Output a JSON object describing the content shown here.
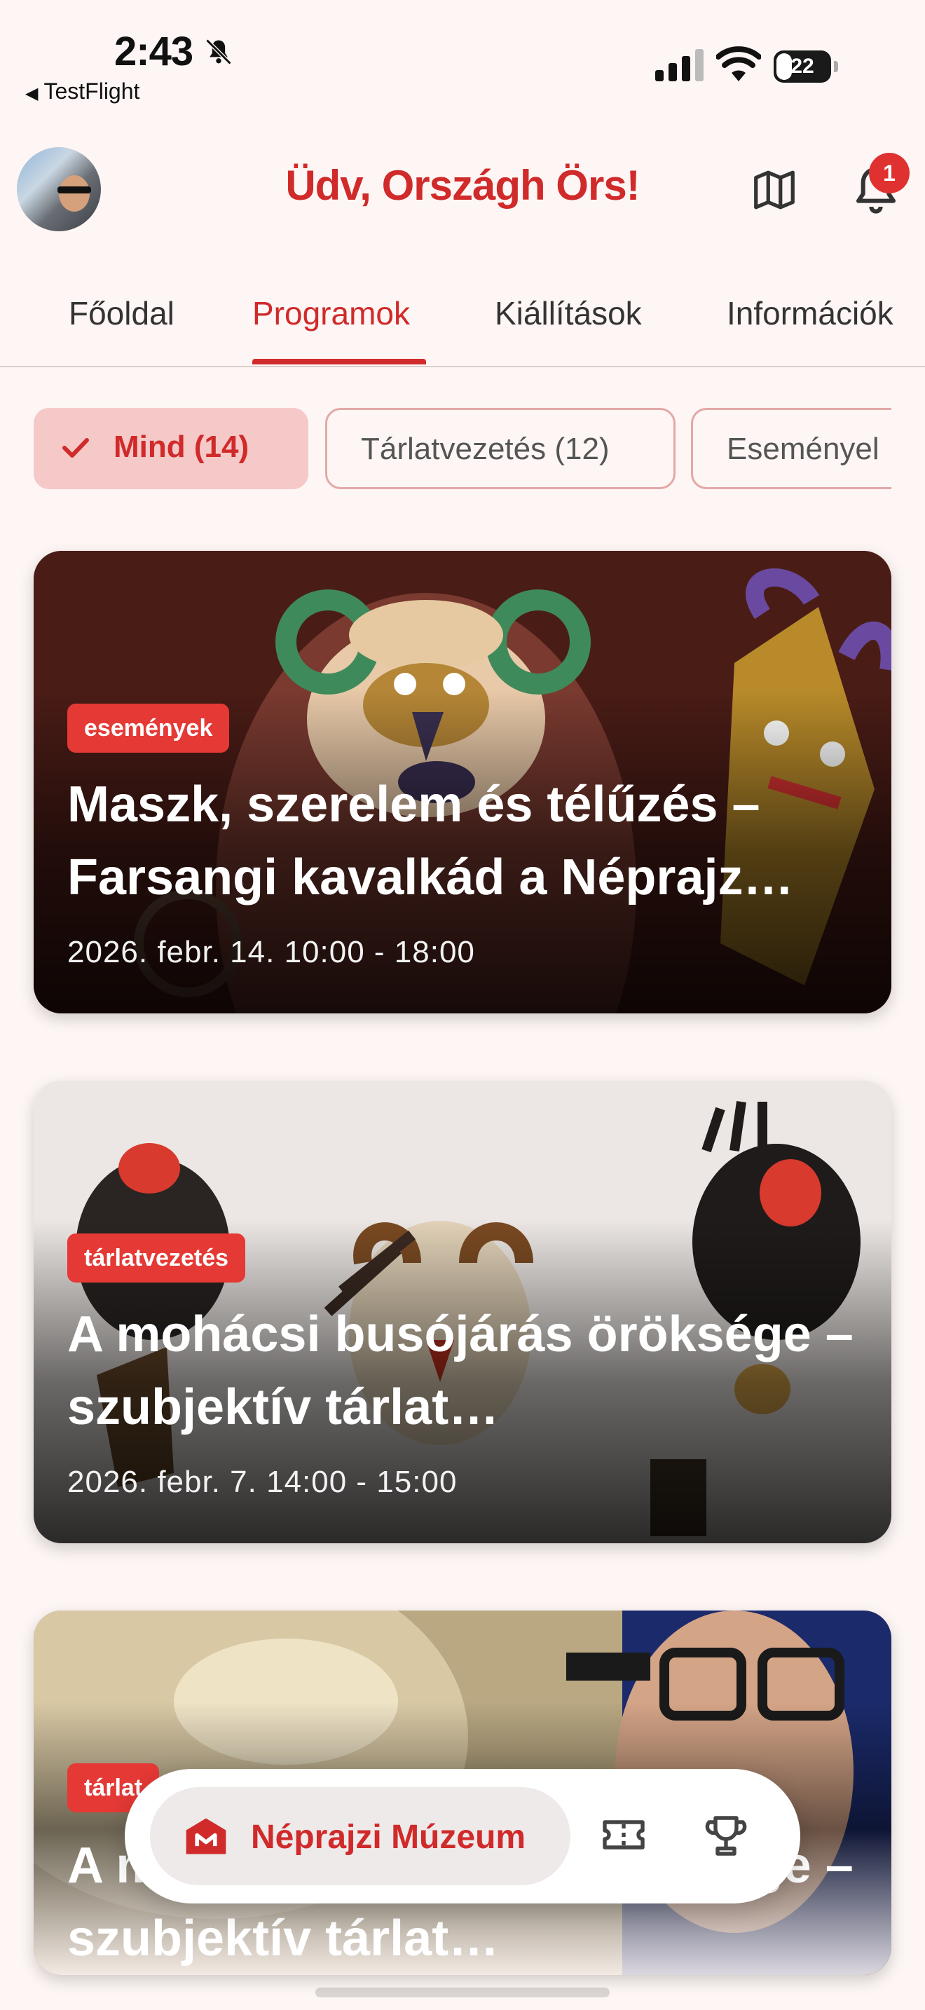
{
  "status_bar": {
    "time": "2:43",
    "back_app": "TestFlight",
    "battery": "22"
  },
  "header": {
    "greeting": "Üdv, Országh Örs!",
    "notification_count": "1"
  },
  "tabs": [
    {
      "label": "Főoldal",
      "active": false
    },
    {
      "label": "Programok",
      "active": true
    },
    {
      "label": "Kiállítások",
      "active": false
    },
    {
      "label": "Információk",
      "active": false
    }
  ],
  "filters": [
    {
      "label": "Mind (14)",
      "selected": true
    },
    {
      "label": "Tárlatvezetés (12)",
      "selected": false
    },
    {
      "label": "Eseményel",
      "selected": false
    }
  ],
  "events": [
    {
      "category": "események",
      "title": "Maszk, szerelem és télűzés – Farsangi kavalkád a Néprajz…",
      "date": "2026. febr. 14. 10:00 - 18:00"
    },
    {
      "category": "tárlatvezetés",
      "title": "A mohácsi busójárás öröksége – szubjektív tárlat…",
      "date": "2026. febr. 7. 14:00 - 15:00"
    },
    {
      "category": "tárlat",
      "title": "A mohácsi busójárás öröksége – szubjektív tárlat…",
      "date": ""
    }
  ],
  "bottom_nav": {
    "home_label": "Néprajzi Múzeum",
    "icons": [
      "museum-icon",
      "ticket-icon",
      "trophy-icon"
    ]
  },
  "colors": {
    "accent": "#d02a2a",
    "badge": "#e53935",
    "background": "#fdf6f4"
  }
}
